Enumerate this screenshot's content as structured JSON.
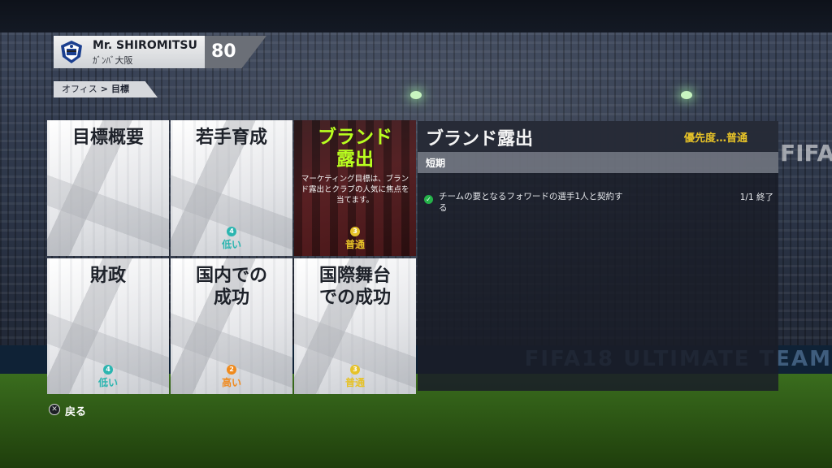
{
  "background": {
    "banner_text": "FIFA18 ULTIMATE TEAM",
    "brand_text": "FIFA"
  },
  "profile": {
    "name": "Mr. SHIROMITSU",
    "club": "ｶﾞﾝﾊﾞ大阪",
    "rating": "80",
    "crest_icon": "club-crest-icon"
  },
  "breadcrumb": {
    "parent": "オフィス",
    "current": "目標"
  },
  "tiles": [
    {
      "title": "目標概要",
      "priority_num": "",
      "priority_label": "",
      "priority_color": ""
    },
    {
      "title": "若手育成",
      "priority_num": "4",
      "priority_label": "低い",
      "priority_color": "#2bb5b0"
    },
    {
      "title": "ブランド\n露出",
      "priority_num": "3",
      "priority_label": "普通",
      "priority_color": "#e6c228",
      "description": "マーケティング目標は、ブランド露出とクラブの人気に焦点を当てます。",
      "selected": true
    },
    {
      "title": "財政",
      "priority_num": "4",
      "priority_label": "低い",
      "priority_color": "#2bb5b0"
    },
    {
      "title": "国内での\n成功",
      "priority_num": "2",
      "priority_label": "高い",
      "priority_color": "#f08a1c"
    },
    {
      "title": "国際舞台\nでの成功",
      "priority_num": "3",
      "priority_label": "普通",
      "priority_color": "#e6c228"
    }
  ],
  "detail": {
    "title": "ブランド露出",
    "priority": "優先度…普通",
    "section": "短期",
    "objectives": [
      {
        "text": "チームの要となるフォワードの選手1人と契約する",
        "status": "1/1 終了",
        "done": true
      }
    ]
  },
  "footer": {
    "back_button_icon": "cross-button-icon",
    "back_label": "戻る"
  },
  "colors": {
    "accent_selected_title": "#b9ff1f",
    "priority_medium": "#e6c228",
    "priority_low": "#2bb5b0",
    "priority_high": "#f08a1c",
    "check": "#25b24a"
  }
}
